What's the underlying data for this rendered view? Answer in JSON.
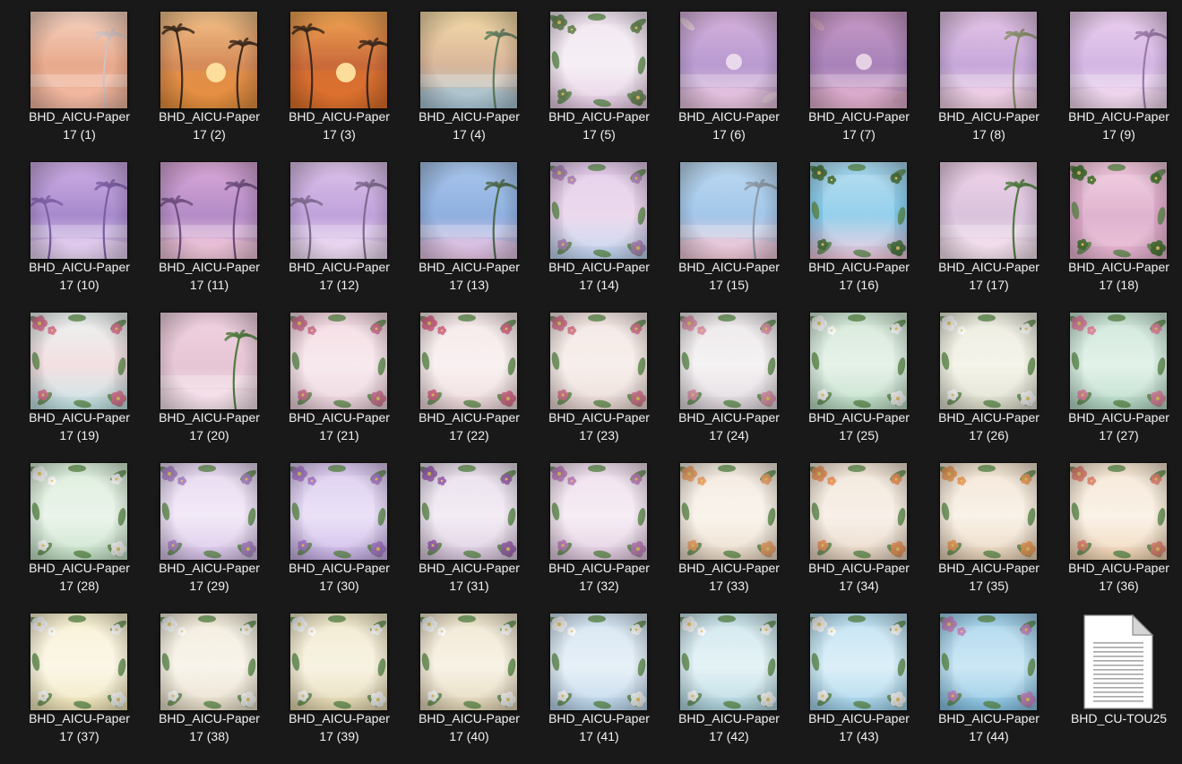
{
  "window": {
    "view": "large-icons"
  },
  "icons": {
    "palm": "palm-tree-icon",
    "flower": "flower-icon",
    "document": "document-icon"
  },
  "files": [
    {
      "name": "BHD_AICU-Paper\n17 (1)",
      "theme": "palm-beach",
      "palette": [
        "#f6d3c2",
        "#f3b9a2",
        "#e8a98c",
        "#cfc1c0"
      ]
    },
    {
      "name": "BHD_AICU-Paper\n17 (2)",
      "theme": "palm-sunset",
      "palette": [
        "#f4c38a",
        "#e8903d",
        "#d58b5a",
        "#e9c3a6"
      ]
    },
    {
      "name": "BHD_AICU-Paper\n17 (3)",
      "theme": "palm-sunset",
      "palette": [
        "#f2a654",
        "#e0712c",
        "#c96a3a",
        "#f2c28a"
      ]
    },
    {
      "name": "BHD_AICU-Paper\n17 (4)",
      "theme": "palm-beach",
      "palette": [
        "#f5dba8",
        "#a9c6d6",
        "#d9b69a",
        "#5f7c5d"
      ]
    },
    {
      "name": "BHD_AICU-Paper\n17 (5)",
      "theme": "floral-frame",
      "palette": [
        "#efe2ef",
        "#e3c9e1",
        "#f4ecf3",
        "#6f8b5a"
      ]
    },
    {
      "name": "BHD_AICU-Paper\n17 (6)",
      "theme": "pastel-sea",
      "palette": [
        "#d7b2dc",
        "#e8c4e0",
        "#b89ad1",
        "#f0d7e4"
      ]
    },
    {
      "name": "BHD_AICU-Paper\n17 (7)",
      "theme": "pastel-sea",
      "palette": [
        "#c99ac6",
        "#e3b0cf",
        "#a782b9",
        "#d8a7c0"
      ]
    },
    {
      "name": "BHD_AICU-Paper\n17 (8)",
      "theme": "palm-beach",
      "palette": [
        "#e6c6e7",
        "#f2d2e6",
        "#c6a7d9",
        "#8a8f6a"
      ]
    },
    {
      "name": "BHD_AICU-Paper\n17 (9)",
      "theme": "palm-beach",
      "palette": [
        "#ecd0ee",
        "#f2d9ef",
        "#d4b6e4",
        "#9a7aa8"
      ]
    },
    {
      "name": "BHD_AICU-Paper\n17 (10)",
      "theme": "palm-lilac",
      "palette": [
        "#cfaee6",
        "#e8d3f1",
        "#a78acc",
        "#7d5fa3"
      ]
    },
    {
      "name": "BHD_AICU-Paper\n17 (11)",
      "theme": "palm-lilac",
      "palette": [
        "#d9a8d8",
        "#f0c6d9",
        "#b48cc7",
        "#6f4f7f"
      ]
    },
    {
      "name": "BHD_AICU-Paper\n17 (12)",
      "theme": "palm-lilac",
      "palette": [
        "#ddc2ea",
        "#efdcf3",
        "#c0a2db",
        "#7f6a8f"
      ]
    },
    {
      "name": "BHD_AICU-Paper\n17 (13)",
      "theme": "palm-beach",
      "palette": [
        "#a9c6ec",
        "#e4c3e3",
        "#8fb0e0",
        "#4f6a4a"
      ]
    },
    {
      "name": "BHD_AICU-Paper\n17 (14)",
      "theme": "floral-frame",
      "palette": [
        "#dfc7e6",
        "#bcd4ef",
        "#e9d1ea",
        "#b48cc0"
      ]
    },
    {
      "name": "BHD_AICU-Paper\n17 (15)",
      "theme": "palm-beach",
      "palette": [
        "#bcd9f1",
        "#f1c9d8",
        "#a3c7ea",
        "#8e9aa6"
      ]
    },
    {
      "name": "BHD_AICU-Paper\n17 (16)",
      "theme": "floral-frame",
      "palette": [
        "#a9d8ee",
        "#f3c9dd",
        "#7fc6e8",
        "#4e7a46"
      ]
    },
    {
      "name": "BHD_AICU-Paper\n17 (17)",
      "theme": "palm-beach",
      "palette": [
        "#f0d3ea",
        "#f5e1ee",
        "#d9c2dc",
        "#4f7b3f"
      ]
    },
    {
      "name": "BHD_AICU-Paper\n17 (18)",
      "theme": "floral-frame",
      "palette": [
        "#f3c9df",
        "#e9b7d3",
        "#d8a3c4",
        "#4d7a3b"
      ]
    },
    {
      "name": "BHD_AICU-Paper\n17 (19)",
      "theme": "floral-frame",
      "palette": [
        "#e9f0ee",
        "#bfe3e4",
        "#f0d9dc",
        "#e07a98"
      ]
    },
    {
      "name": "BHD_AICU-Paper\n17 (20)",
      "theme": "palm-beach",
      "palette": [
        "#f1d3e1",
        "#f7e3ec",
        "#e6c5d4",
        "#4f7d3e"
      ]
    },
    {
      "name": "BHD_AICU-Paper\n17 (21)",
      "theme": "floral-frame",
      "palette": [
        "#f2d6df",
        "#ead0da",
        "#f6e5ea",
        "#d8799a"
      ]
    },
    {
      "name": "BHD_AICU-Paper\n17 (22)",
      "theme": "floral-frame",
      "palette": [
        "#f4e6e6",
        "#ecd6d8",
        "#f8eeee",
        "#df6f8f"
      ]
    },
    {
      "name": "BHD_AICU-Paper\n17 (23)",
      "theme": "floral-frame",
      "palette": [
        "#f1e4e0",
        "#e7d6d2",
        "#f6ece8",
        "#dd7c95"
      ]
    },
    {
      "name": "BHD_AICU-Paper\n17 (24)",
      "theme": "floral-frame",
      "palette": [
        "#eae6e8",
        "#ddd6db",
        "#f3eff1",
        "#e59ab2"
      ]
    },
    {
      "name": "BHD_AICU-Paper\n17 (25)",
      "theme": "floral-frame",
      "palette": [
        "#cfe6d4",
        "#b9dbc3",
        "#e1efe4",
        "#ffffff"
      ]
    },
    {
      "name": "BHD_AICU-Paper\n17 (26)",
      "theme": "floral-frame",
      "palette": [
        "#e9e9dc",
        "#dcdccb",
        "#f2f2e6",
        "#ffffff"
      ]
    },
    {
      "name": "BHD_AICU-Paper\n17 (27)",
      "theme": "floral-frame",
      "palette": [
        "#c8e3d4",
        "#b3d8c4",
        "#dcefe5",
        "#e58aa6"
      ]
    },
    {
      "name": "BHD_AICU-Paper\n17 (28)",
      "theme": "floral-frame",
      "palette": [
        "#d6ead6",
        "#c3e0c6",
        "#e6f2e6",
        "#ffffff"
      ]
    },
    {
      "name": "BHD_AICU-Paper\n17 (29)",
      "theme": "floral-frame",
      "palette": [
        "#e3d4ee",
        "#d4c0e6",
        "#efe4f6",
        "#b48bd0"
      ]
    },
    {
      "name": "BHD_AICU-Paper\n17 (30)",
      "theme": "floral-frame",
      "palette": [
        "#d8c6ee",
        "#c7b1e6",
        "#e6dbf5",
        "#b080d3"
      ]
    },
    {
      "name": "BHD_AICU-Paper\n17 (31)",
      "theme": "floral-frame",
      "palette": [
        "#e6dbe9",
        "#d8c8dd",
        "#f0e8f2",
        "#a46ab8"
      ]
    },
    {
      "name": "BHD_AICU-Paper\n17 (32)",
      "theme": "floral-frame",
      "palette": [
        "#ecdbea",
        "#e0c9de",
        "#f4e9f2",
        "#c585c2"
      ]
    },
    {
      "name": "BHD_AICU-Paper\n17 (33)",
      "theme": "floral-frame",
      "palette": [
        "#f2e8dc",
        "#e9d9c6",
        "#f8f1e8",
        "#f3a76f"
      ]
    },
    {
      "name": "BHD_AICU-Paper\n17 (34)",
      "theme": "floral-frame",
      "palette": [
        "#f0e3d4",
        "#e5d2bf",
        "#f7eee4",
        "#f39a62"
      ]
    },
    {
      "name": "BHD_AICU-Paper\n17 (35)",
      "theme": "floral-frame",
      "palette": [
        "#f1e2cf",
        "#e7d1b8",
        "#f8efe3",
        "#f2a25f"
      ]
    },
    {
      "name": "BHD_AICU-Paper\n17 (36)",
      "theme": "floral-frame",
      "palette": [
        "#f4e4cf",
        "#efd2b1",
        "#f9efe2",
        "#e98b7a"
      ]
    },
    {
      "name": "BHD_AICU-Paper\n17 (37)",
      "theme": "floral-frame",
      "palette": [
        "#f7efcf",
        "#efe4b7",
        "#fbf6e2",
        "#ffffff"
      ]
    },
    {
      "name": "BHD_AICU-Paper\n17 (38)",
      "theme": "floral-frame",
      "palette": [
        "#f1ead9",
        "#e6dcc6",
        "#f7f2e7",
        "#ffffff"
      ]
    },
    {
      "name": "BHD_AICU-Paper\n17 (39)",
      "theme": "floral-frame",
      "palette": [
        "#efe7c8",
        "#e2d6ad",
        "#f6f0dc",
        "#ffffff"
      ]
    },
    {
      "name": "BHD_AICU-Paper\n17 (40)",
      "theme": "floral-frame",
      "palette": [
        "#eee4cc",
        "#e1d4b4",
        "#f6efdf",
        "#ffffff"
      ]
    },
    {
      "name": "BHD_AICU-Paper\n17 (41)",
      "theme": "floral-frame",
      "palette": [
        "#cfe1ef",
        "#b8d3ea",
        "#e2edf6",
        "#ffffff"
      ]
    },
    {
      "name": "BHD_AICU-Paper\n17 (42)",
      "theme": "floral-frame",
      "palette": [
        "#c7e3ea",
        "#afd5df",
        "#dff0f4",
        "#ffffff"
      ]
    },
    {
      "name": "BHD_AICU-Paper\n17 (43)",
      "theme": "floral-frame",
      "palette": [
        "#b8def0",
        "#a0d2ea",
        "#d4ecf7",
        "#ffffff"
      ]
    },
    {
      "name": "BHD_AICU-Paper\n17 (44)",
      "theme": "floral-frame",
      "palette": [
        "#9fd0ea",
        "#86c2e3",
        "#c1e2f2",
        "#c88bc9"
      ]
    },
    {
      "name": "BHD_CU-TOU25",
      "theme": "document",
      "palette": [
        "#ffffff",
        "#e9e9e9",
        "#9a9a9a",
        "#cfcfcf"
      ]
    }
  ]
}
